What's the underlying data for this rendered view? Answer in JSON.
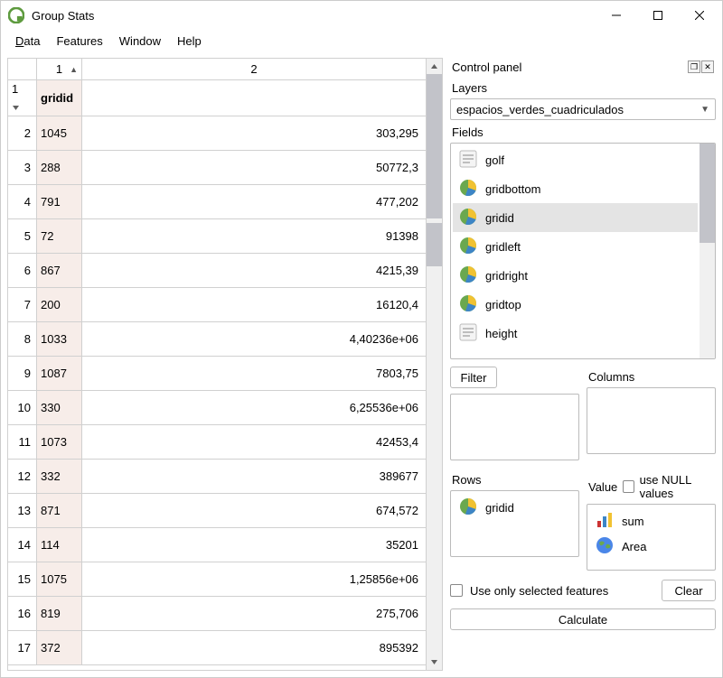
{
  "window": {
    "title": "Group Stats"
  },
  "menu": {
    "data": "Data",
    "features": "Features",
    "window": "Window",
    "help": "Help"
  },
  "table": {
    "col1_header": "1",
    "col2_header": "2",
    "row1_col1": "gridid",
    "rows": [
      {
        "num": "1",
        "c1": "gridid",
        "c2": ""
      },
      {
        "num": "2",
        "c1": "1045",
        "c2": "303,295"
      },
      {
        "num": "3",
        "c1": "288",
        "c2": "50772,3"
      },
      {
        "num": "4",
        "c1": "791",
        "c2": "477,202"
      },
      {
        "num": "5",
        "c1": "72",
        "c2": "91398"
      },
      {
        "num": "6",
        "c1": "867",
        "c2": "4215,39"
      },
      {
        "num": "7",
        "c1": "200",
        "c2": "16120,4"
      },
      {
        "num": "8",
        "c1": "1033",
        "c2": "4,40236e+06"
      },
      {
        "num": "9",
        "c1": "1087",
        "c2": "7803,75"
      },
      {
        "num": "10",
        "c1": "330",
        "c2": "6,25536e+06"
      },
      {
        "num": "11",
        "c1": "1073",
        "c2": "42453,4"
      },
      {
        "num": "12",
        "c1": "332",
        "c2": "389677"
      },
      {
        "num": "13",
        "c1": "871",
        "c2": "674,572"
      },
      {
        "num": "14",
        "c1": "114",
        "c2": "35201"
      },
      {
        "num": "15",
        "c1": "1075",
        "c2": "1,25856e+06"
      },
      {
        "num": "16",
        "c1": "819",
        "c2": "275,706"
      },
      {
        "num": "17",
        "c1": "372",
        "c2": "895392"
      }
    ]
  },
  "panel": {
    "title": "Control panel",
    "layers_label": "Layers",
    "layer_value": "espacios_verdes_cuadriculados",
    "fields_label": "Fields",
    "fields": [
      {
        "name": "golf",
        "icon": "text"
      },
      {
        "name": "gridbottom",
        "icon": "pie"
      },
      {
        "name": "gridid",
        "icon": "pie",
        "selected": true
      },
      {
        "name": "gridleft",
        "icon": "pie"
      },
      {
        "name": "gridright",
        "icon": "pie"
      },
      {
        "name": "gridtop",
        "icon": "pie"
      },
      {
        "name": "height",
        "icon": "text"
      }
    ],
    "filter_label": "Filter",
    "columns_label": "Columns",
    "rows_label": "Rows",
    "value_label": "Value",
    "null_label": "use NULL values",
    "rows_box": [
      {
        "name": "gridid",
        "icon": "pie"
      }
    ],
    "value_box": [
      {
        "name": "sum",
        "icon": "bars"
      },
      {
        "name": "Area",
        "icon": "globe"
      }
    ],
    "use_only_label": "Use only selected features",
    "clear_label": "Clear",
    "calculate_label": "Calculate"
  }
}
